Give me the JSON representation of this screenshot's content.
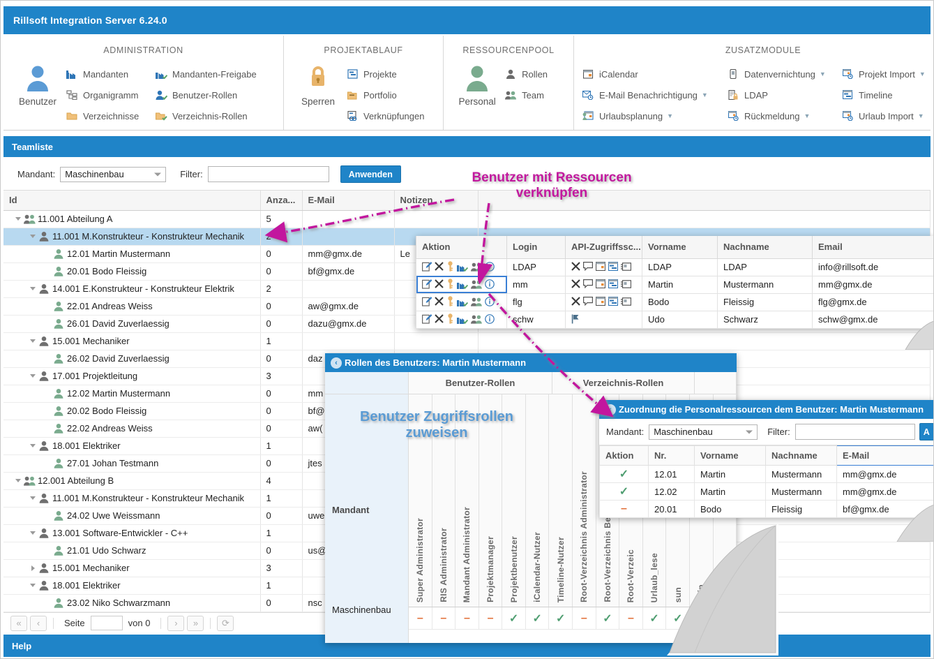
{
  "window": {
    "title": "Rillsoft Integration Server 6.24.0"
  },
  "ribbon": {
    "groups": [
      {
        "title": "ADMINISTRATION",
        "big": {
          "label": "Benutzer",
          "icon": "user-icon"
        },
        "items": [
          {
            "label": "Mandanten",
            "icon": "factory-icon",
            "caret": false
          },
          {
            "label": "Organigramm",
            "icon": "orgchart-icon",
            "caret": false
          },
          {
            "label": "Verzeichnisse",
            "icon": "folder-icon",
            "caret": false
          }
        ],
        "items2": [
          {
            "label": "Mandanten-Freigabe",
            "icon": "factory-check-icon",
            "caret": false
          },
          {
            "label": "Benutzer-Rollen",
            "icon": "user-check-icon",
            "caret": false
          },
          {
            "label": "Verzeichnis-Rollen",
            "icon": "folder-check-icon",
            "caret": false
          }
        ]
      },
      {
        "title": "PROJEKTABLAUF",
        "big": {
          "label": "Sperren",
          "icon": "lock-icon"
        },
        "items": [
          {
            "label": "Projekte",
            "icon": "project-icon",
            "caret": false
          },
          {
            "label": "Portfolio",
            "icon": "portfolio-icon",
            "caret": false
          },
          {
            "label": "Verknüpfungen",
            "icon": "link-icon",
            "caret": false
          }
        ],
        "items2": []
      },
      {
        "title": "RESSOURCENPOOL",
        "big": {
          "label": "Personal",
          "icon": "person-icon"
        },
        "items": [
          {
            "label": "Rollen",
            "icon": "role-icon",
            "caret": false
          },
          {
            "label": "Team",
            "icon": "team-icon",
            "caret": false
          }
        ],
        "items2": []
      },
      {
        "title": "ZUSATZMODULE",
        "big": null,
        "items": [
          {
            "label": "iCalendar",
            "icon": "calendar-icon",
            "caret": false
          },
          {
            "label": "E-Mail Benachrichtigung",
            "icon": "mail-clock-icon",
            "caret": true
          },
          {
            "label": "Urlaubsplanung",
            "icon": "vacation-icon",
            "caret": true
          }
        ],
        "items2": [
          {
            "label": "Datenvernichtung",
            "icon": "shredder-icon",
            "caret": true
          },
          {
            "label": "LDAP",
            "icon": "ldap-lock-icon",
            "caret": false
          },
          {
            "label": "Rückmeldung",
            "icon": "feedback-clock-icon",
            "caret": true
          }
        ],
        "items3": [
          {
            "label": "Projekt Import",
            "icon": "project-import-icon",
            "caret": true
          },
          {
            "label": "Timeline",
            "icon": "timeline-icon",
            "caret": false
          },
          {
            "label": "Urlaub Import",
            "icon": "vacation-import-icon",
            "caret": true
          }
        ]
      }
    ]
  },
  "section": {
    "title": "Teamliste"
  },
  "filterbar": {
    "mandant_label": "Mandant:",
    "mandant_value": "Maschinenbau",
    "filter_label": "Filter:",
    "filter_value": "",
    "filter_placeholder": "",
    "apply_label": "Anwenden"
  },
  "grid": {
    "columns": [
      "Id",
      "Anza...",
      "E-Mail",
      "Notizen",
      ""
    ],
    "rows": [
      {
        "level": 0,
        "twisty": "open",
        "icon": "team-icon",
        "id": "11.001 Abteilung A",
        "anzahl": "5",
        "email": "",
        "notizen": "",
        "selected": false
      },
      {
        "level": 1,
        "twisty": "open",
        "icon": "person-icon",
        "id": "11.001 M.Konstrukteur - Konstrukteur Mechanik",
        "anzahl": "2",
        "email": "",
        "notizen": "",
        "selected": true
      },
      {
        "level": 2,
        "twisty": "none",
        "icon": "person-green-icon",
        "id": "12.01 Martin Mustermann",
        "anzahl": "0",
        "email": "mm@gmx.de",
        "notizen": "Le",
        "selected": false
      },
      {
        "level": 2,
        "twisty": "none",
        "icon": "person-green-icon",
        "id": "20.01 Bodo Fleissig",
        "anzahl": "0",
        "email": "bf@gmx.de",
        "notizen": "",
        "selected": false
      },
      {
        "level": 1,
        "twisty": "open",
        "icon": "person-icon",
        "id": "14.001 E.Konstrukteur - Konstrukteur Elektrik",
        "anzahl": "2",
        "email": "",
        "notizen": "",
        "selected": false
      },
      {
        "level": 2,
        "twisty": "none",
        "icon": "person-green-icon",
        "id": "22.01 Andreas Weiss",
        "anzahl": "0",
        "email": "aw@gmx.de",
        "notizen": "",
        "selected": false
      },
      {
        "level": 2,
        "twisty": "none",
        "icon": "person-green-icon",
        "id": "26.01 David Zuverlaessig",
        "anzahl": "0",
        "email": "dazu@gmx.de",
        "notizen": "",
        "selected": false
      },
      {
        "level": 1,
        "twisty": "open",
        "icon": "person-icon",
        "id": "15.001 Mechaniker",
        "anzahl": "1",
        "email": "",
        "notizen": "",
        "selected": false
      },
      {
        "level": 2,
        "twisty": "none",
        "icon": "person-green-icon",
        "id": "26.02 David Zuverlaessig",
        "anzahl": "0",
        "email": "daz",
        "notizen": "",
        "selected": false
      },
      {
        "level": 1,
        "twisty": "open",
        "icon": "person-icon",
        "id": "17.001 Projektleitung",
        "anzahl": "3",
        "email": "",
        "notizen": "",
        "selected": false
      },
      {
        "level": 2,
        "twisty": "none",
        "icon": "person-green-icon",
        "id": "12.02 Martin Mustermann",
        "anzahl": "0",
        "email": "mm",
        "notizen": "",
        "selected": false
      },
      {
        "level": 2,
        "twisty": "none",
        "icon": "person-green-icon",
        "id": "20.02 Bodo Fleissig",
        "anzahl": "0",
        "email": "bf@",
        "notizen": "",
        "selected": false
      },
      {
        "level": 2,
        "twisty": "none",
        "icon": "person-green-icon",
        "id": "22.02 Andreas Weiss",
        "anzahl": "0",
        "email": "aw(",
        "notizen": "",
        "selected": false
      },
      {
        "level": 1,
        "twisty": "open",
        "icon": "person-icon",
        "id": "18.001 Elektriker",
        "anzahl": "1",
        "email": "",
        "notizen": "",
        "selected": false
      },
      {
        "level": 2,
        "twisty": "none",
        "icon": "person-green-icon",
        "id": "27.01 Johan Testmann",
        "anzahl": "0",
        "email": "jtes",
        "notizen": "",
        "selected": false
      },
      {
        "level": 0,
        "twisty": "open",
        "icon": "team-icon",
        "id": "12.001 Abteilung B",
        "anzahl": "4",
        "email": "",
        "notizen": "",
        "selected": false
      },
      {
        "level": 1,
        "twisty": "open",
        "icon": "person-icon",
        "id": "11.001 M.Konstrukteur - Konstrukteur Mechanik",
        "anzahl": "1",
        "email": "",
        "notizen": "",
        "selected": false
      },
      {
        "level": 2,
        "twisty": "none",
        "icon": "person-green-icon",
        "id": "24.02 Uwe Weissmann",
        "anzahl": "0",
        "email": "uwe",
        "notizen": "",
        "selected": false
      },
      {
        "level": 1,
        "twisty": "open",
        "icon": "person-icon",
        "id": "13.001 Software-Entwickler - C++",
        "anzahl": "1",
        "email": "",
        "notizen": "",
        "selected": false
      },
      {
        "level": 2,
        "twisty": "none",
        "icon": "person-green-icon",
        "id": "21.01 Udo Schwarz",
        "anzahl": "0",
        "email": "us@",
        "notizen": "",
        "selected": false
      },
      {
        "level": 1,
        "twisty": "closed",
        "icon": "person-icon",
        "id": "15.001 Mechaniker",
        "anzahl": "3",
        "email": "",
        "notizen": "",
        "selected": false
      },
      {
        "level": 1,
        "twisty": "open",
        "icon": "person-icon",
        "id": "18.001 Elektriker",
        "anzahl": "1",
        "email": "",
        "notizen": "",
        "selected": false
      },
      {
        "level": 2,
        "twisty": "none",
        "icon": "person-green-icon",
        "id": "23.02 Niko Schwarzmann",
        "anzahl": "0",
        "email": "nsc",
        "notizen": "",
        "selected": false
      }
    ]
  },
  "pager": {
    "first": "«",
    "prev": "‹",
    "next": "›",
    "last": "»",
    "refresh": "⟳",
    "page_label": "Seite",
    "page_value": "",
    "of_label": "von 0"
  },
  "help": {
    "label": "Help"
  },
  "user_popup": {
    "columns": [
      "Aktion",
      "Login",
      "API-Zugriffssc...",
      "Vorname",
      "Nachname",
      "Email"
    ],
    "action_icons": [
      "edit-icon",
      "delete-icon",
      "key-icon",
      "roles-icon",
      "resources-icon",
      "info-icon"
    ],
    "api_icons": [
      "x-icon",
      "comment-icon",
      "calendar-icon",
      "timeline-icon",
      "card-icon"
    ],
    "rows": [
      {
        "login": "LDAP",
        "api": "full",
        "vorname": "LDAP",
        "nachname": "LDAP",
        "email": "info@rillsoft.de",
        "muted": true,
        "highlighted": false
      },
      {
        "login": "mm",
        "api": "full",
        "vorname": "Martin",
        "nachname": "Mustermann",
        "email": "mm@gmx.de",
        "muted": false,
        "highlighted": true
      },
      {
        "login": "flg",
        "api": "full",
        "vorname": "Bodo",
        "nachname": "Fleissig",
        "email": "flg@gmx.de",
        "muted": false,
        "highlighted": false
      },
      {
        "login": "schw",
        "api": "flag",
        "vorname": "Udo",
        "nachname": "Schwarz",
        "email": "schw@gmx.de",
        "muted": false,
        "highlighted": false
      }
    ]
  },
  "roles_popup": {
    "title": "Rollen des Benutzers: Martin Mustermann",
    "group_headers": [
      "",
      "Benutzer-Rollen",
      "Verzeichnis-Rollen"
    ],
    "row_label_header": "Mandant",
    "role_columns": [
      "Super Administrator",
      "RIS Administrator",
      "Mandant Administrator",
      "Projektmanager",
      "Projektbenutzer",
      "iCalendar-Nutzer",
      "Timeline-Nutzer",
      "Root-Verzeichnis Administrator",
      "Root-Verzeichnis Benutzer",
      "Root-Verzeic",
      "Urlaub_lese",
      "sun",
      "eLin",
      ""
    ],
    "rows": [
      {
        "label": "Maschinenbau",
        "values": [
          "dash",
          "dash",
          "dash",
          "dash",
          "check",
          "check",
          "check",
          "dash",
          "check",
          "dash",
          "check",
          "check",
          "",
          ""
        ]
      }
    ]
  },
  "personal_popup": {
    "title": "Zuordnung die Personalressourcen dem Benutzer: Martin Mustermann",
    "mandant_label": "Mandant:",
    "mandant_value": "Maschinenbau",
    "filter_label": "Filter:",
    "filter_value": "",
    "apply_label": "A",
    "columns": [
      "Aktion",
      "Nr.",
      "Vorname",
      "Nachname",
      "E-Mail"
    ],
    "active_column": "E-Mail",
    "rows": [
      {
        "action": "check",
        "nr": "12.01",
        "vorname": "Martin",
        "nachname": "Mustermann",
        "email": "mm@gmx.de"
      },
      {
        "action": "check",
        "nr": "12.02",
        "vorname": "Martin",
        "nachname": "Mustermann",
        "email": "mm@gmx.de"
      },
      {
        "action": "dash",
        "nr": "20.01",
        "vorname": "Bodo",
        "nachname": "Fleissig",
        "email": "bf@gmx.de"
      }
    ]
  },
  "annotations": {
    "a1_line1": "Benutzer mit Ressourcen",
    "a1_line2": "verknüpfen",
    "a2_line1": "Benutzer Zugriffsrollen",
    "a2_line2": "zuweisen",
    "pink": "#c2189e",
    "blue": "#5a9bd4"
  }
}
